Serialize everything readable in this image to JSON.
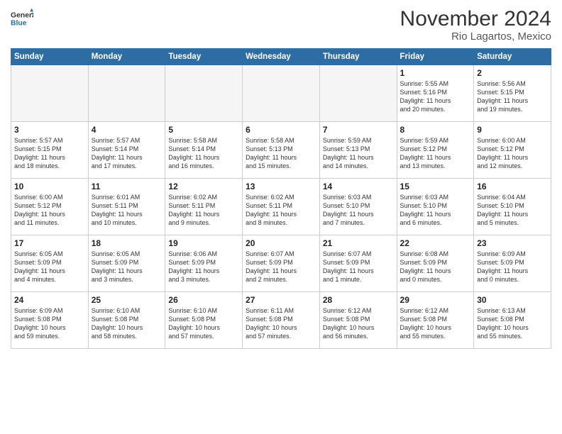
{
  "header": {
    "logo_line1": "General",
    "logo_line2": "Blue",
    "month": "November 2024",
    "location": "Rio Lagartos, Mexico"
  },
  "weekdays": [
    "Sunday",
    "Monday",
    "Tuesday",
    "Wednesday",
    "Thursday",
    "Friday",
    "Saturday"
  ],
  "weeks": [
    [
      {
        "day": "",
        "info": ""
      },
      {
        "day": "",
        "info": ""
      },
      {
        "day": "",
        "info": ""
      },
      {
        "day": "",
        "info": ""
      },
      {
        "day": "",
        "info": ""
      },
      {
        "day": "1",
        "info": "Sunrise: 5:55 AM\nSunset: 5:16 PM\nDaylight: 11 hours\nand 20 minutes."
      },
      {
        "day": "2",
        "info": "Sunrise: 5:56 AM\nSunset: 5:15 PM\nDaylight: 11 hours\nand 19 minutes."
      }
    ],
    [
      {
        "day": "3",
        "info": "Sunrise: 5:57 AM\nSunset: 5:15 PM\nDaylight: 11 hours\nand 18 minutes."
      },
      {
        "day": "4",
        "info": "Sunrise: 5:57 AM\nSunset: 5:14 PM\nDaylight: 11 hours\nand 17 minutes."
      },
      {
        "day": "5",
        "info": "Sunrise: 5:58 AM\nSunset: 5:14 PM\nDaylight: 11 hours\nand 16 minutes."
      },
      {
        "day": "6",
        "info": "Sunrise: 5:58 AM\nSunset: 5:13 PM\nDaylight: 11 hours\nand 15 minutes."
      },
      {
        "day": "7",
        "info": "Sunrise: 5:59 AM\nSunset: 5:13 PM\nDaylight: 11 hours\nand 14 minutes."
      },
      {
        "day": "8",
        "info": "Sunrise: 5:59 AM\nSunset: 5:12 PM\nDaylight: 11 hours\nand 13 minutes."
      },
      {
        "day": "9",
        "info": "Sunrise: 6:00 AM\nSunset: 5:12 PM\nDaylight: 11 hours\nand 12 minutes."
      }
    ],
    [
      {
        "day": "10",
        "info": "Sunrise: 6:00 AM\nSunset: 5:12 PM\nDaylight: 11 hours\nand 11 minutes."
      },
      {
        "day": "11",
        "info": "Sunrise: 6:01 AM\nSunset: 5:11 PM\nDaylight: 11 hours\nand 10 minutes."
      },
      {
        "day": "12",
        "info": "Sunrise: 6:02 AM\nSunset: 5:11 PM\nDaylight: 11 hours\nand 9 minutes."
      },
      {
        "day": "13",
        "info": "Sunrise: 6:02 AM\nSunset: 5:11 PM\nDaylight: 11 hours\nand 8 minutes."
      },
      {
        "day": "14",
        "info": "Sunrise: 6:03 AM\nSunset: 5:10 PM\nDaylight: 11 hours\nand 7 minutes."
      },
      {
        "day": "15",
        "info": "Sunrise: 6:03 AM\nSunset: 5:10 PM\nDaylight: 11 hours\nand 6 minutes."
      },
      {
        "day": "16",
        "info": "Sunrise: 6:04 AM\nSunset: 5:10 PM\nDaylight: 11 hours\nand 5 minutes."
      }
    ],
    [
      {
        "day": "17",
        "info": "Sunrise: 6:05 AM\nSunset: 5:09 PM\nDaylight: 11 hours\nand 4 minutes."
      },
      {
        "day": "18",
        "info": "Sunrise: 6:05 AM\nSunset: 5:09 PM\nDaylight: 11 hours\nand 3 minutes."
      },
      {
        "day": "19",
        "info": "Sunrise: 6:06 AM\nSunset: 5:09 PM\nDaylight: 11 hours\nand 3 minutes."
      },
      {
        "day": "20",
        "info": "Sunrise: 6:07 AM\nSunset: 5:09 PM\nDaylight: 11 hours\nand 2 minutes."
      },
      {
        "day": "21",
        "info": "Sunrise: 6:07 AM\nSunset: 5:09 PM\nDaylight: 11 hours\nand 1 minute."
      },
      {
        "day": "22",
        "info": "Sunrise: 6:08 AM\nSunset: 5:09 PM\nDaylight: 11 hours\nand 0 minutes."
      },
      {
        "day": "23",
        "info": "Sunrise: 6:09 AM\nSunset: 5:09 PM\nDaylight: 11 hours\nand 0 minutes."
      }
    ],
    [
      {
        "day": "24",
        "info": "Sunrise: 6:09 AM\nSunset: 5:08 PM\nDaylight: 10 hours\nand 59 minutes."
      },
      {
        "day": "25",
        "info": "Sunrise: 6:10 AM\nSunset: 5:08 PM\nDaylight: 10 hours\nand 58 minutes."
      },
      {
        "day": "26",
        "info": "Sunrise: 6:10 AM\nSunset: 5:08 PM\nDaylight: 10 hours\nand 57 minutes."
      },
      {
        "day": "27",
        "info": "Sunrise: 6:11 AM\nSunset: 5:08 PM\nDaylight: 10 hours\nand 57 minutes."
      },
      {
        "day": "28",
        "info": "Sunrise: 6:12 AM\nSunset: 5:08 PM\nDaylight: 10 hours\nand 56 minutes."
      },
      {
        "day": "29",
        "info": "Sunrise: 6:12 AM\nSunset: 5:08 PM\nDaylight: 10 hours\nand 55 minutes."
      },
      {
        "day": "30",
        "info": "Sunrise: 6:13 AM\nSunset: 5:08 PM\nDaylight: 10 hours\nand 55 minutes."
      }
    ]
  ]
}
